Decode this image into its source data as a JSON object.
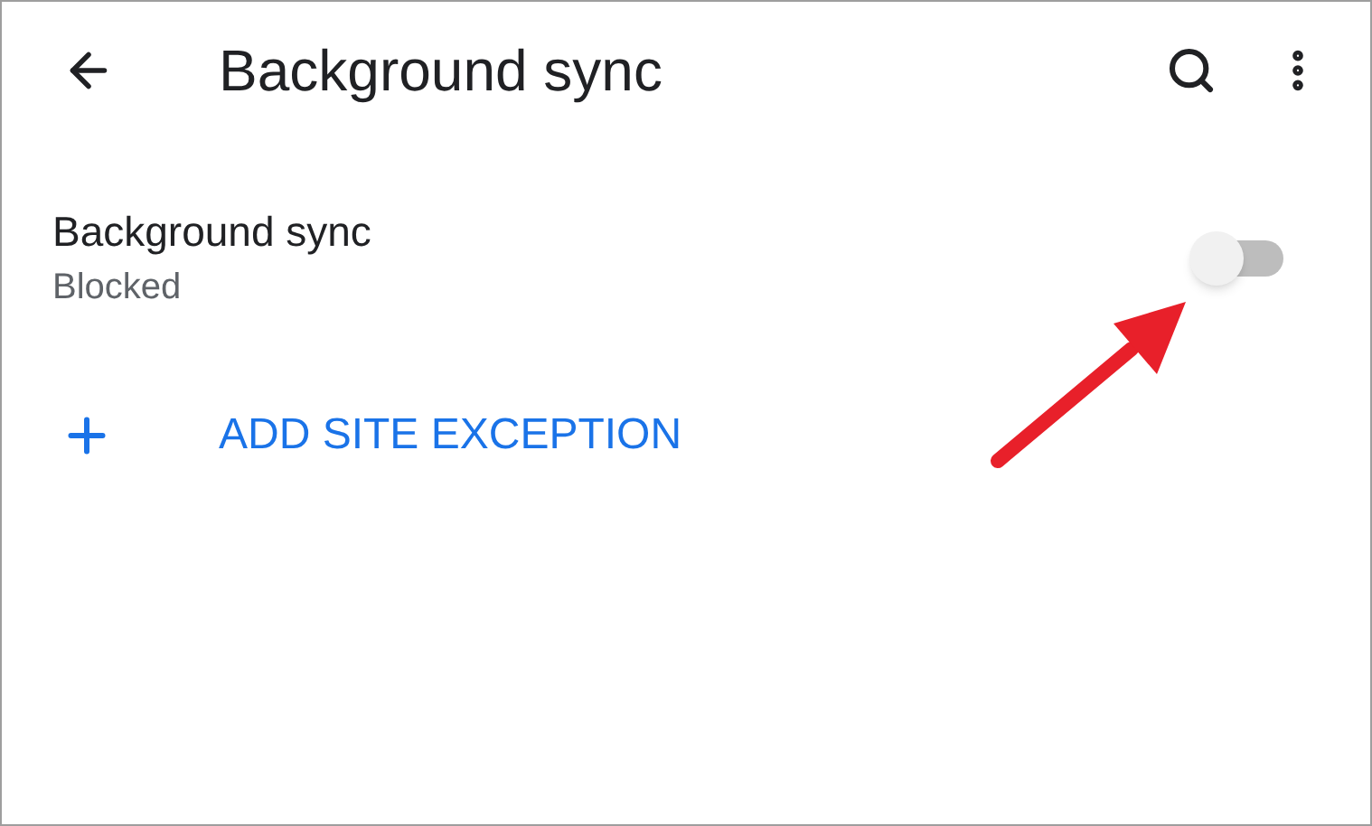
{
  "toolbar": {
    "title": "Background sync"
  },
  "setting": {
    "title": "Background sync",
    "status": "Blocked",
    "on": false
  },
  "add_exception": {
    "label": "ADD SITE EXCEPTION"
  }
}
